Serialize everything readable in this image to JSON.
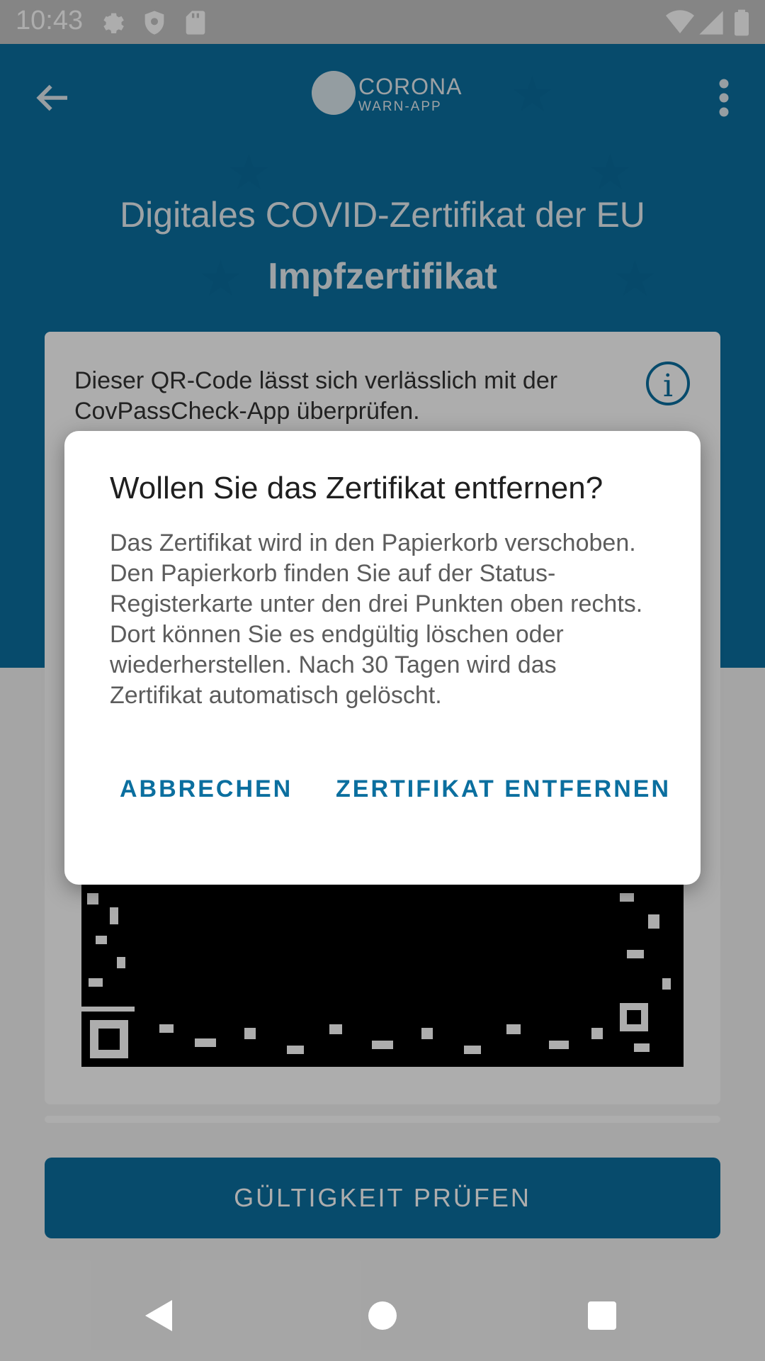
{
  "status_bar": {
    "time": "10:43",
    "icons": [
      "gear-icon",
      "shield-icon",
      "sd-card-icon",
      "wifi-icon",
      "signal-icon",
      "battery-icon"
    ]
  },
  "app_bar": {
    "logo_line1": "CORONA",
    "logo_line2": "WARN-APP",
    "back_icon": "arrow-left-icon",
    "menu_icon": "kebab-menu-icon"
  },
  "header": {
    "title": "Digitales COVID-Zertifikat der EU",
    "subtitle": "Impfzertifikat",
    "color": "#0b6f9f"
  },
  "card": {
    "info_text": "Dieser QR-Code lässt sich verlässlich mit der CovPassCheck-App überprüfen.",
    "info_icon": "info-icon",
    "info_glyph": "i"
  },
  "actions": {
    "validate_label": "GÜLTIGKEIT PRÜFEN"
  },
  "dialog": {
    "title": "Wollen Sie das Zertifikat entfernen?",
    "body": "Das Zertifikat wird in den Papierkorb verschoben. Den Papierkorb finden Sie auf der Status-Registerkarte unter den drei Punkten oben rechts. Dort können Sie es endgültig löschen oder wiederherstellen. Nach 30 Tagen wird das Zertifikat automatisch gelöscht.",
    "cancel_label": "ABBRECHEN",
    "confirm_label": "ZERTIFIKAT ENTFERNEN",
    "button_color": "#0b6f9f"
  },
  "nav_bar": {
    "icons": [
      "nav-back-icon",
      "nav-home-icon",
      "nav-recents-icon"
    ]
  }
}
